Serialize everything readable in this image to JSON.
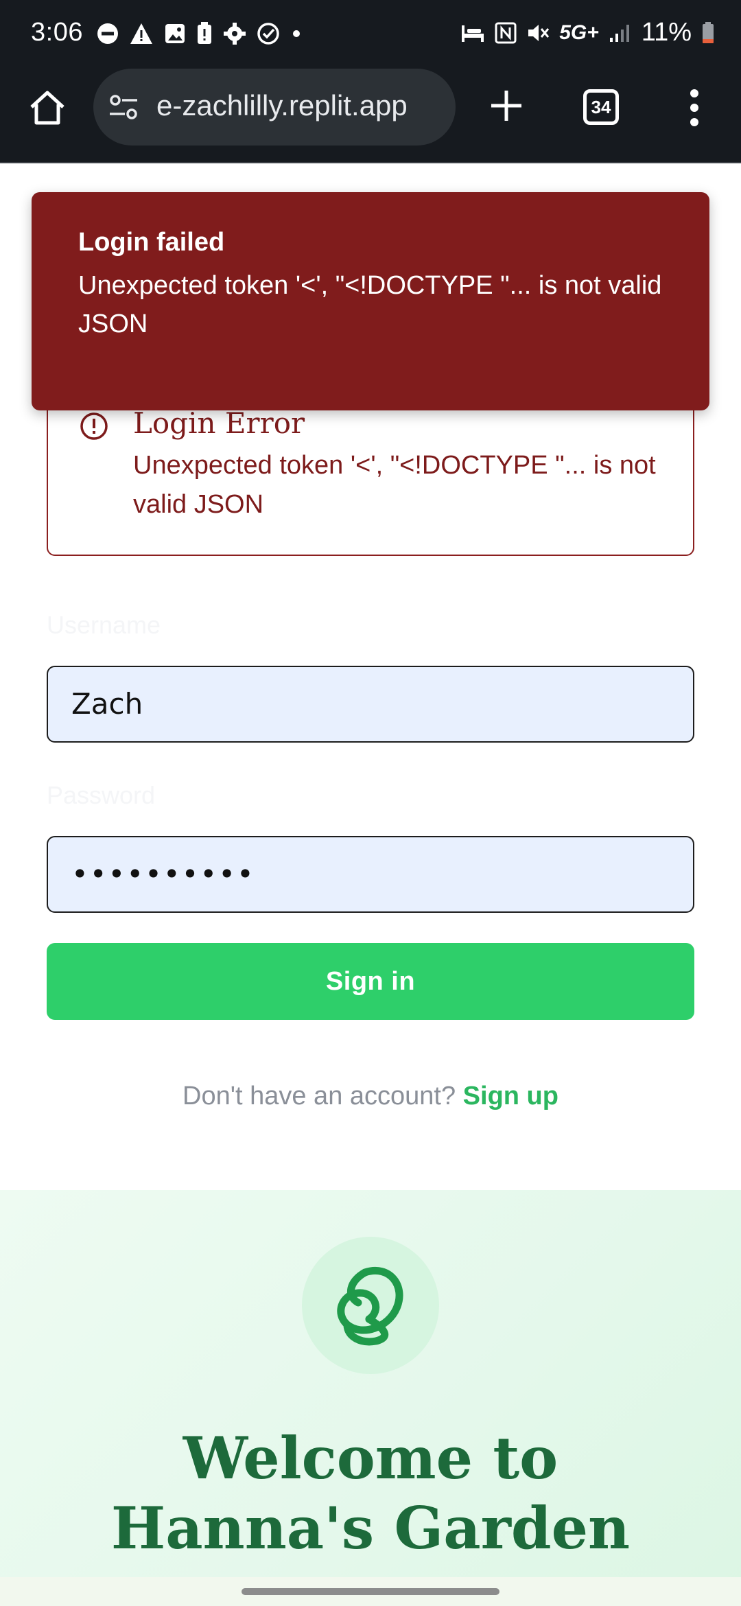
{
  "status_bar": {
    "time": "3:06",
    "network": "5G+",
    "battery": "11%",
    "left_icons": [
      "do-not-disturb-icon",
      "warning-icon",
      "image-icon",
      "battery-alert-icon",
      "settings-gear-icon",
      "check-circle-icon",
      "dot-icon"
    ],
    "right_icons": [
      "bed-icon",
      "nfc-icon",
      "mute-icon",
      "signal-icon",
      "battery-icon"
    ]
  },
  "browser": {
    "url": "e-zachlilly.replit.app",
    "tab_count": "34"
  },
  "toast": {
    "title": "Login failed",
    "message": "Unexpected token '<', \"<!DOCTYPE \"... is not valid JSON"
  },
  "error_alert": {
    "title": "Login Error",
    "message": "Unexpected token '<', \"<!DOCTYPE \"... is not valid JSON"
  },
  "form": {
    "username_label": "Username",
    "username_value": "Zach",
    "password_label": "Password",
    "password_value": "••••••••••",
    "submit_label": "Sign in",
    "signup_prompt": "Don't have an account?",
    "signup_link": "Sign up"
  },
  "hero": {
    "title": "Welcome to Hanna's Garden"
  },
  "colors": {
    "toast_bg": "#801c1c",
    "error_text": "#7d1b1b",
    "input_bg": "#e8f0fe",
    "primary_green": "#2ecf6a",
    "link_green": "#2bb65f",
    "hero_title": "#1d6a3b",
    "browser_bg": "#161a1f"
  }
}
